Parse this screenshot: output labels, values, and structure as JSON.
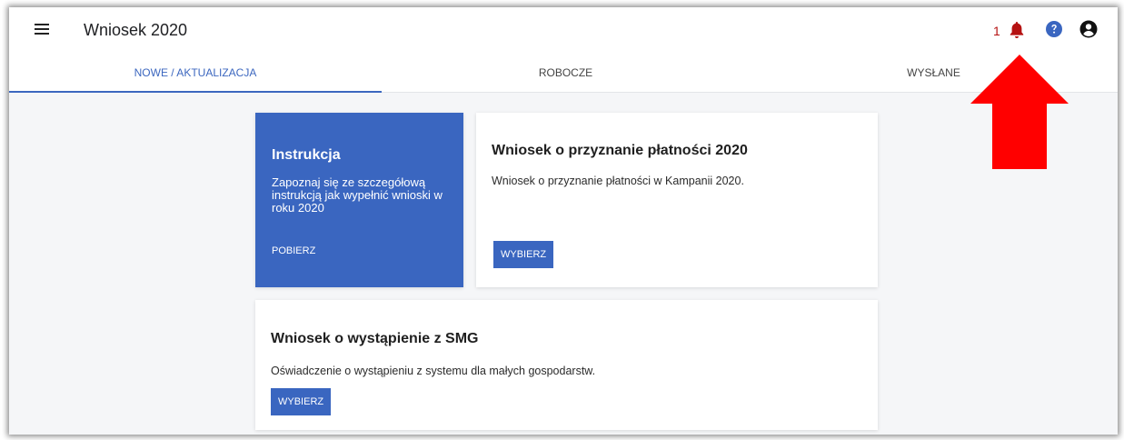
{
  "header": {
    "menu_icon": "hamburger-menu-icon",
    "title": "Wniosek 2020",
    "notification_count": "1",
    "bell_icon": "bell-icon",
    "help_icon": "help-icon",
    "user_icon": "account-icon"
  },
  "tabs": [
    {
      "label": "NOWE / AKTUALIZACJA",
      "active": true
    },
    {
      "label": "ROBOCZE",
      "active": false
    },
    {
      "label": "WYSŁANE",
      "active": false
    }
  ],
  "instruction_card": {
    "title": "Instrukcja",
    "description": "Zapoznaj się ze szczegółową instrukcją jak wypełnić wnioski w roku 2020",
    "link_label": "POBIERZ"
  },
  "payment_card": {
    "title": "Wniosek o przyznanie płatności 2020",
    "description": "Wniosek o przyznanie płatności w Kampanii 2020.",
    "button_label": "WYBIERZ"
  },
  "smg_card": {
    "title": "Wniosek o wystąpienie z SMG",
    "description": "Oświadczenie o wystąpieniu z systemu dla małych gospodarstw.",
    "button_label": "WYBIERZ"
  },
  "colors": {
    "accent": "#3a66c0",
    "notification": "#b51212",
    "annotation_arrow": "#ff0000"
  }
}
